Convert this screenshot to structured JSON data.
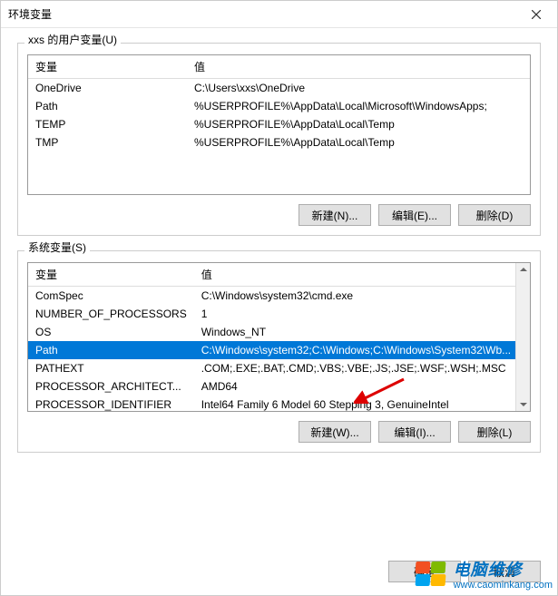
{
  "window": {
    "title": "环境变量"
  },
  "user_group": {
    "label": "xxs 的用户变量(U)",
    "headers": {
      "name": "变量",
      "value": "值"
    },
    "rows": [
      {
        "name": "OneDrive",
        "value": "C:\\Users\\xxs\\OneDrive"
      },
      {
        "name": "Path",
        "value": "%USERPROFILE%\\AppData\\Local\\Microsoft\\WindowsApps;"
      },
      {
        "name": "TEMP",
        "value": "%USERPROFILE%\\AppData\\Local\\Temp"
      },
      {
        "name": "TMP",
        "value": "%USERPROFILE%\\AppData\\Local\\Temp"
      }
    ],
    "buttons": {
      "new": "新建(N)...",
      "edit": "编辑(E)...",
      "delete": "删除(D)"
    }
  },
  "sys_group": {
    "label": "系统变量(S)",
    "headers": {
      "name": "变量",
      "value": "值"
    },
    "rows": [
      {
        "name": "ComSpec",
        "value": "C:\\Windows\\system32\\cmd.exe"
      },
      {
        "name": "NUMBER_OF_PROCESSORS",
        "value": "1"
      },
      {
        "name": "OS",
        "value": "Windows_NT"
      },
      {
        "name": "Path",
        "value": "C:\\Windows\\system32;C:\\Windows;C:\\Windows\\System32\\Wb...",
        "selected": true
      },
      {
        "name": "PATHEXT",
        "value": ".COM;.EXE;.BAT;.CMD;.VBS;.VBE;.JS;.JSE;.WSF;.WSH;.MSC"
      },
      {
        "name": "PROCESSOR_ARCHITECT...",
        "value": "AMD64"
      },
      {
        "name": "PROCESSOR_IDENTIFIER",
        "value": "Intel64 Family 6 Model 60 Stepping 3, GenuineIntel"
      }
    ],
    "buttons": {
      "new": "新建(W)...",
      "edit": "编辑(I)...",
      "delete": "删除(L)"
    }
  },
  "footer": {
    "ok": "确定",
    "cancel": "取消"
  },
  "watermark": {
    "line1": "电脑维修",
    "line2": "www.caominkang.com"
  }
}
